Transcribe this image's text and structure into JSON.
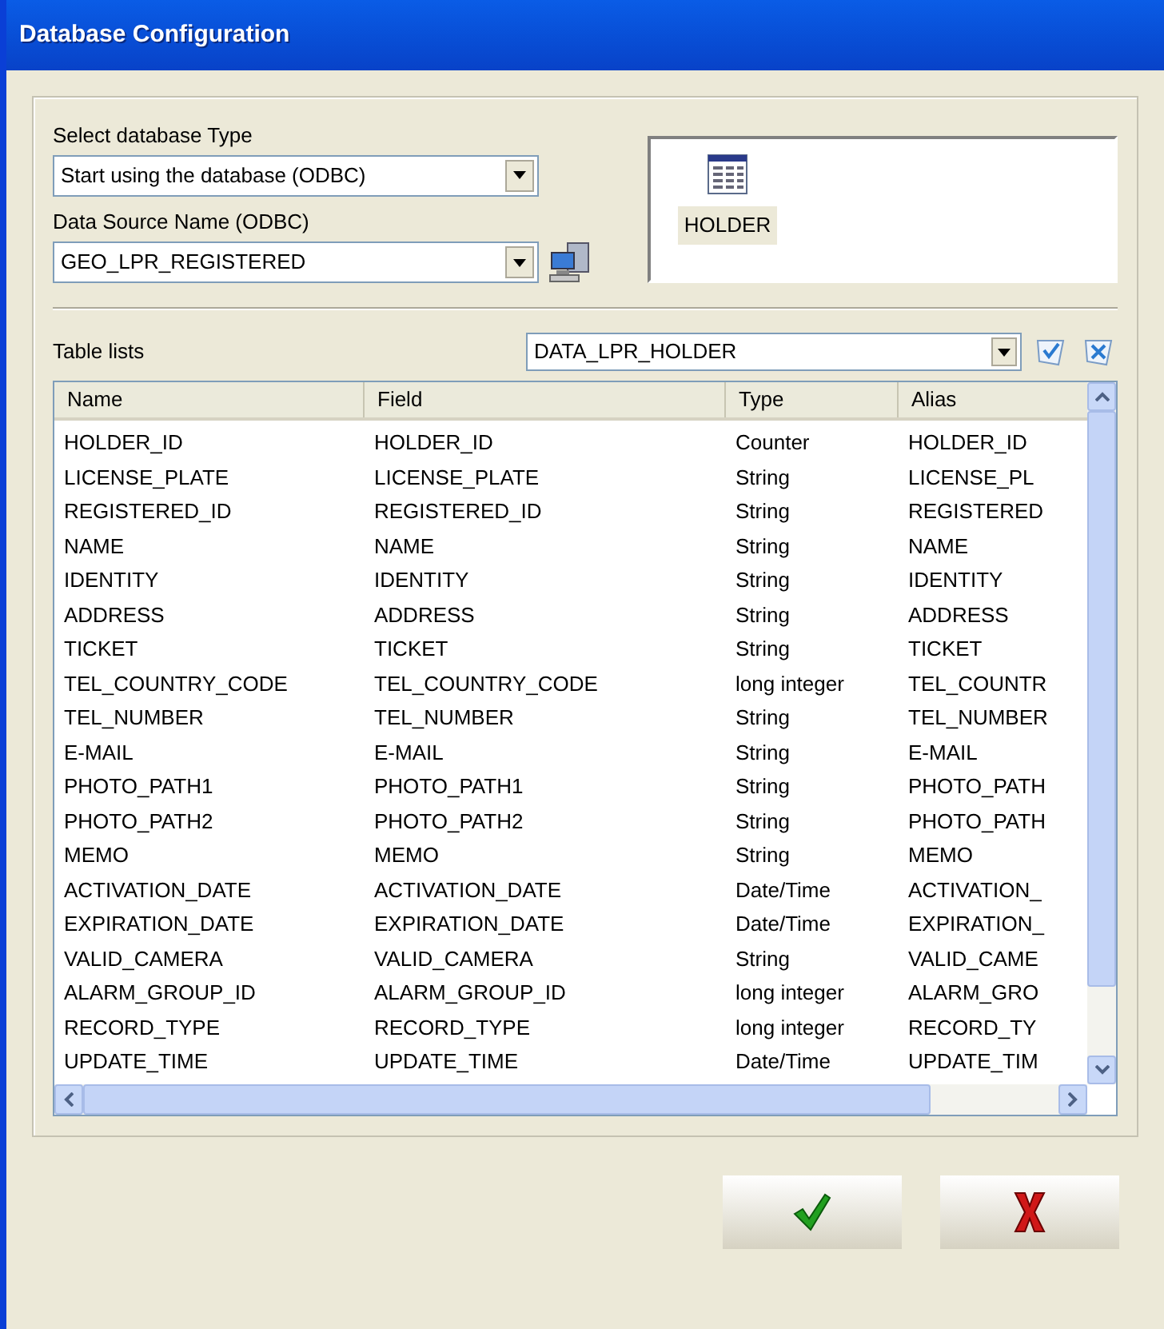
{
  "window": {
    "title": "Database Configuration"
  },
  "db_type": {
    "label": "Select database Type",
    "value": "Start using the database (ODBC)"
  },
  "dsn": {
    "label": "Data Source Name (ODBC)",
    "value": "GEO_LPR_REGISTERED"
  },
  "tables_panel": {
    "items": [
      {
        "label": "HOLDER",
        "selected": true
      }
    ]
  },
  "table_lists": {
    "label": "Table lists",
    "value": "DATA_LPR_HOLDER"
  },
  "table": {
    "columns": [
      "Name",
      "Field",
      "Type",
      "Alias"
    ],
    "rows": [
      [
        "HOLDER_ID",
        "HOLDER_ID",
        "Counter",
        "HOLDER_ID"
      ],
      [
        "LICENSE_PLATE",
        "LICENSE_PLATE",
        "String",
        "LICENSE_PL"
      ],
      [
        "REGISTERED_ID",
        "REGISTERED_ID",
        "String",
        "REGISTERED"
      ],
      [
        "NAME",
        "NAME",
        "String",
        "NAME"
      ],
      [
        "IDENTITY",
        "IDENTITY",
        "String",
        "IDENTITY"
      ],
      [
        "ADDRESS",
        "ADDRESS",
        "String",
        "ADDRESS"
      ],
      [
        "TICKET",
        "TICKET",
        "String",
        "TICKET"
      ],
      [
        "TEL_COUNTRY_CODE",
        "TEL_COUNTRY_CODE",
        "long integer",
        "TEL_COUNTR"
      ],
      [
        "TEL_NUMBER",
        "TEL_NUMBER",
        "String",
        "TEL_NUMBER"
      ],
      [
        "E-MAIL",
        "E-MAIL",
        "String",
        "E-MAIL"
      ],
      [
        "PHOTO_PATH1",
        "PHOTO_PATH1",
        "String",
        "PHOTO_PATH"
      ],
      [
        "PHOTO_PATH2",
        "PHOTO_PATH2",
        "String",
        "PHOTO_PATH"
      ],
      [
        "MEMO",
        "MEMO",
        "String",
        "MEMO"
      ],
      [
        "ACTIVATION_DATE",
        "ACTIVATION_DATE",
        "Date/Time",
        "ACTIVATION_"
      ],
      [
        "EXPIRATION_DATE",
        "EXPIRATION_DATE",
        "Date/Time",
        "EXPIRATION_"
      ],
      [
        "VALID_CAMERA",
        "VALID_CAMERA",
        "String",
        "VALID_CAME"
      ],
      [
        "ALARM_GROUP_ID",
        "ALARM_GROUP_ID",
        "long integer",
        "ALARM_GRO"
      ],
      [
        "RECORD_TYPE",
        "RECORD_TYPE",
        "long integer",
        "RECORD_TY"
      ],
      [
        "UPDATE_TIME",
        "UPDATE_TIME",
        "Date/Time",
        "UPDATE_TIM"
      ]
    ]
  }
}
